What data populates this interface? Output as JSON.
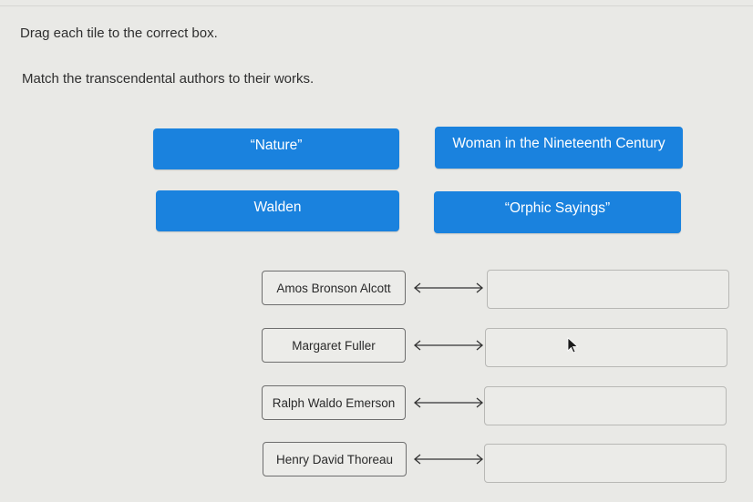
{
  "instructions": {
    "line1": "Drag each tile to the correct box.",
    "line2": "Match the transcendental authors to their works."
  },
  "tiles": [
    {
      "label": "“Nature”"
    },
    {
      "label": "Woman in the Nineteenth Century"
    },
    {
      "label": "Walden"
    },
    {
      "label": "“Orphic Sayings”"
    }
  ],
  "pairs": [
    {
      "author": "Amos Bronson Alcott",
      "arrow_icon": "double-arrow-icon",
      "target": ""
    },
    {
      "author": "Margaret Fuller",
      "arrow_icon": "double-arrow-icon",
      "target": ""
    },
    {
      "author": "Ralph Waldo Emerson",
      "arrow_icon": "double-arrow-icon",
      "target": ""
    },
    {
      "author": "Henry David Thoreau",
      "arrow_icon": "double-arrow-icon",
      "target": ""
    }
  ],
  "colors": {
    "tile_bg": "#1a82de",
    "tile_text": "#ffffff",
    "background": "#e9e9e6"
  }
}
